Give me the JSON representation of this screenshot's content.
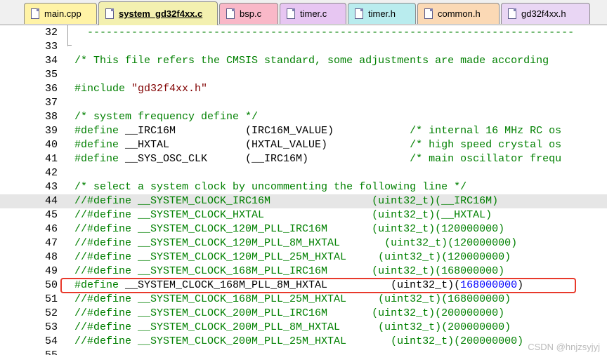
{
  "tabs": [
    {
      "label": "main.cpp",
      "color": "#fff3a6",
      "active": false
    },
    {
      "label": "system_gd32f4xx.c",
      "color": "#f3f0b0",
      "active": true
    },
    {
      "label": "bsp.c",
      "color": "#f9b8c8",
      "active": false
    },
    {
      "label": "timer.c",
      "color": "#e7c6f2",
      "active": false
    },
    {
      "label": "timer.h",
      "color": "#b9ecee",
      "active": false
    },
    {
      "label": "common.h",
      "color": "#fbd9b5",
      "active": false
    },
    {
      "label": "gd32f4xx.h",
      "color": "#e9d6f4",
      "active": false
    }
  ],
  "lines": [
    {
      "num": "32",
      "parts": [
        {
          "t": "  -----------------------------------------------------------------------------",
          "c": "c-comment"
        }
      ]
    },
    {
      "num": "33",
      "parts": []
    },
    {
      "num": "34",
      "parts": [
        {
          "t": "/* This file refers the CMSIS standard, some adjustments are made according",
          "c": "c-comment"
        }
      ]
    },
    {
      "num": "35",
      "parts": []
    },
    {
      "num": "36",
      "parts": [
        {
          "t": "#include ",
          "c": "c-pp"
        },
        {
          "t": "\"gd32f4xx.h\"",
          "c": "c-str"
        }
      ]
    },
    {
      "num": "37",
      "parts": []
    },
    {
      "num": "38",
      "parts": [
        {
          "t": "/* system frequency define */",
          "c": "c-comment"
        }
      ]
    },
    {
      "num": "39",
      "parts": [
        {
          "t": "#define ",
          "c": "c-pp"
        },
        {
          "t": "__IRC16M           (IRC16M_VALUE)            ",
          "c": "c-plain"
        },
        {
          "t": "/* internal 16 MHz RC os",
          "c": "c-comment"
        }
      ]
    },
    {
      "num": "40",
      "parts": [
        {
          "t": "#define ",
          "c": "c-pp"
        },
        {
          "t": "__HXTAL            (HXTAL_VALUE)             ",
          "c": "c-plain"
        },
        {
          "t": "/* high speed crystal os",
          "c": "c-comment"
        }
      ]
    },
    {
      "num": "41",
      "parts": [
        {
          "t": "#define ",
          "c": "c-pp"
        },
        {
          "t": "__SYS_OSC_CLK      (__IRC16M)                ",
          "c": "c-plain"
        },
        {
          "t": "/* main oscillator frequ",
          "c": "c-comment"
        }
      ]
    },
    {
      "num": "42",
      "parts": []
    },
    {
      "num": "43",
      "parts": [
        {
          "t": "/* select a system clock by uncommenting the following line */",
          "c": "c-comment"
        }
      ]
    },
    {
      "num": "44",
      "current": true,
      "parts": [
        {
          "t": "//#define __SYSTEM_CLOCK_IRC16M                (uint32_t)(__IRC16M)",
          "c": "c-comment"
        }
      ]
    },
    {
      "num": "45",
      "parts": [
        {
          "t": "//#define __SYSTEM_CLOCK_HXTAL                 (uint32_t)(__HXTAL)",
          "c": "c-comment"
        }
      ]
    },
    {
      "num": "46",
      "parts": [
        {
          "t": "//#define __SYSTEM_CLOCK_120M_PLL_IRC16M       (uint32_t)(120000000)",
          "c": "c-comment"
        }
      ]
    },
    {
      "num": "47",
      "parts": [
        {
          "t": "//#define __SYSTEM_CLOCK_120M_PLL_8M_HXTAL       (uint32_t)(120000000)",
          "c": "c-comment"
        }
      ]
    },
    {
      "num": "48",
      "parts": [
        {
          "t": "//#define __SYSTEM_CLOCK_120M_PLL_25M_HXTAL     (uint32_t)(120000000)",
          "c": "c-comment"
        }
      ]
    },
    {
      "num": "49",
      "parts": [
        {
          "t": "//#define __SYSTEM_CLOCK_168M_PLL_IRC16M       (uint32_t)(168000000)",
          "c": "c-comment"
        }
      ]
    },
    {
      "num": "50",
      "parts": [
        {
          "t": "#define ",
          "c": "c-pp"
        },
        {
          "t": "__SYSTEM_CLOCK_168M_PLL_8M_HXTAL          (uint32_t)(",
          "c": "c-plain"
        },
        {
          "t": "168000000",
          "c": "c-num"
        },
        {
          "t": ")",
          "c": "c-plain"
        }
      ]
    },
    {
      "num": "51",
      "parts": [
        {
          "t": "//#define __SYSTEM_CLOCK_168M_PLL_25M_HXTAL     (uint32_t)(168000000)",
          "c": "c-comment"
        }
      ]
    },
    {
      "num": "52",
      "parts": [
        {
          "t": "//#define __SYSTEM_CLOCK_200M_PLL_IRC16M       (uint32_t)(200000000)",
          "c": "c-comment"
        }
      ]
    },
    {
      "num": "53",
      "parts": [
        {
          "t": "//#define __SYSTEM_CLOCK_200M_PLL_8M_HXTAL      (uint32_t)(200000000)",
          "c": "c-comment"
        }
      ]
    },
    {
      "num": "54",
      "parts": [
        {
          "t": "//#define __SYSTEM_CLOCK_200M_PLL_25M_HXTAL       (uint32_t)(200000000)",
          "c": "c-comment"
        }
      ]
    },
    {
      "num": "55",
      "parts": []
    }
  ],
  "watermark": "CSDN @hnjzsyjyj"
}
